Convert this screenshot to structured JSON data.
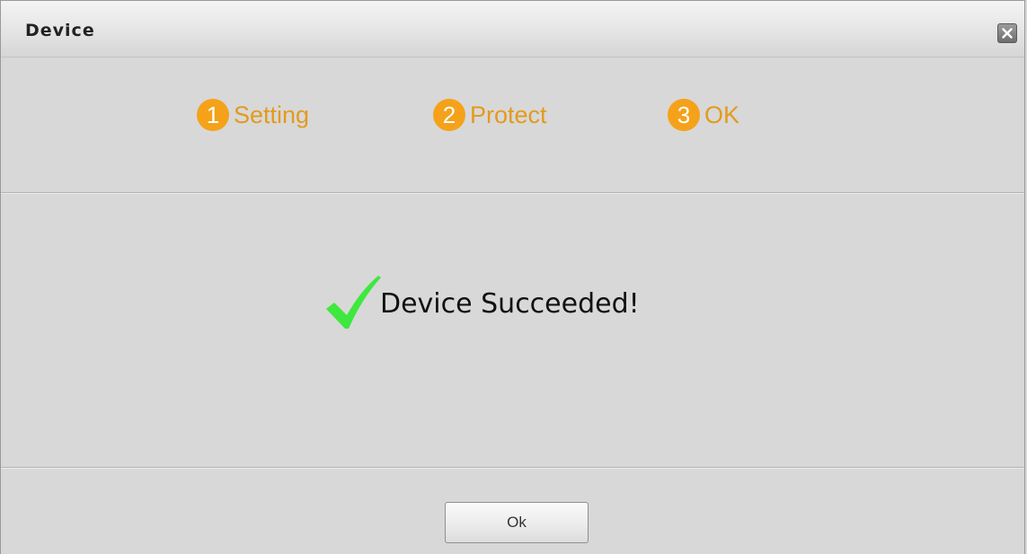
{
  "window": {
    "title": "Device"
  },
  "steps": [
    {
      "number": "1",
      "label": "Setting"
    },
    {
      "number": "2",
      "label": "Protect"
    },
    {
      "number": "3",
      "label": "OK"
    }
  ],
  "result": {
    "icon": "checkmark-icon",
    "message": "Device Succeeded!"
  },
  "footer": {
    "ok_label": "Ok"
  },
  "colors": {
    "step_accent": "#f5a21a",
    "step_label": "#e39a1e",
    "check": "#3ee83e",
    "dialog_bg": "#d8d8d8"
  }
}
